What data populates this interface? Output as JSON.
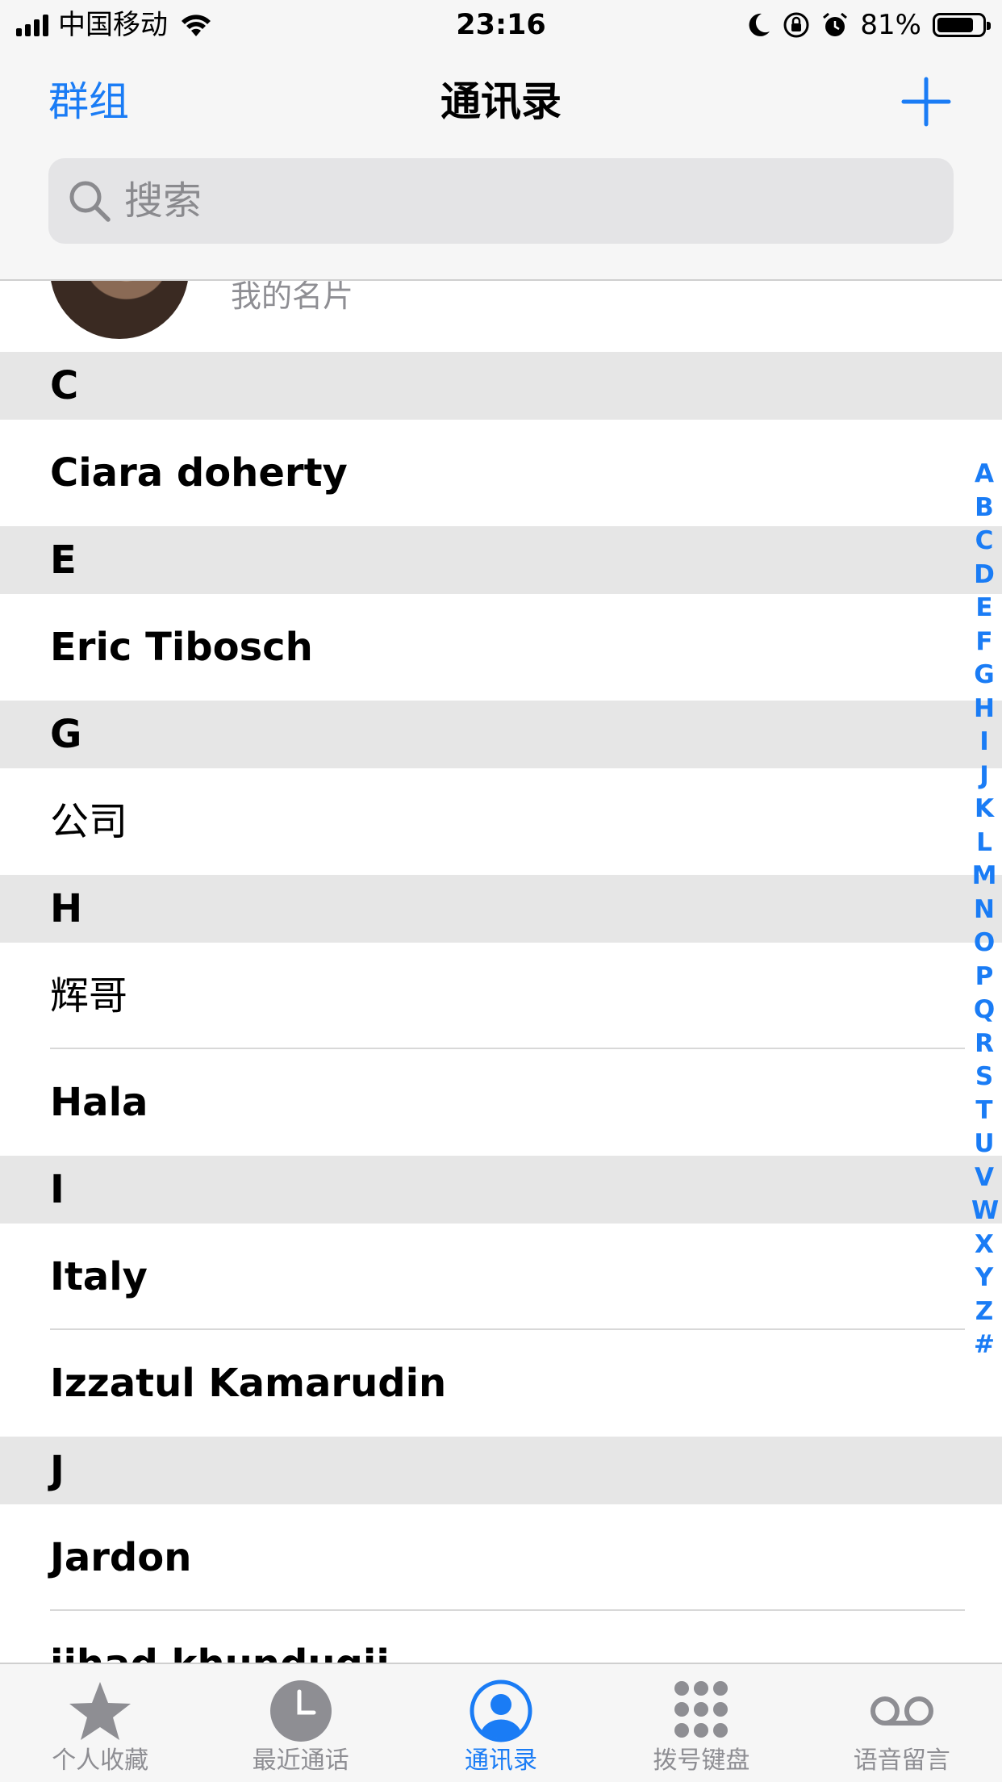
{
  "status_bar": {
    "carrier": "中国移动",
    "time": "23:16",
    "battery_percent": "81%",
    "battery_level": 0.81,
    "icons": [
      "signal-icon",
      "wifi-icon",
      "moon-icon",
      "rotation-lock-icon",
      "alarm-icon",
      "battery-icon"
    ]
  },
  "nav": {
    "groups_label": "群组",
    "title": "通讯录",
    "add_icon": "plus-icon"
  },
  "search": {
    "placeholder": "搜索",
    "icon": "search-icon"
  },
  "my_card": {
    "label": "我的名片"
  },
  "sections": [
    {
      "letter": "C",
      "contacts": [
        "Ciara doherty"
      ]
    },
    {
      "letter": "E",
      "contacts": [
        "Eric Tibosch"
      ]
    },
    {
      "letter": "G",
      "contacts": [
        "公司"
      ]
    },
    {
      "letter": "H",
      "contacts": [
        "辉哥",
        "Hala"
      ]
    },
    {
      "letter": "I",
      "contacts": [
        "Italy",
        "Izzatul Kamarudin"
      ]
    },
    {
      "letter": "J",
      "contacts": [
        "Jardon",
        "jihad khundugii"
      ]
    }
  ],
  "alphabet_index": [
    "A",
    "B",
    "C",
    "D",
    "E",
    "F",
    "G",
    "H",
    "I",
    "J",
    "K",
    "L",
    "M",
    "N",
    "O",
    "P",
    "Q",
    "R",
    "S",
    "T",
    "U",
    "V",
    "W",
    "X",
    "Y",
    "Z",
    "#"
  ],
  "tab_bar": {
    "tabs": [
      {
        "label": "个人收藏",
        "icon": "star-icon",
        "active": false
      },
      {
        "label": "最近通话",
        "icon": "clock-icon",
        "active": false
      },
      {
        "label": "通讯录",
        "icon": "person-circle-icon",
        "active": true
      },
      {
        "label": "拨号键盘",
        "icon": "keypad-icon",
        "active": false
      },
      {
        "label": "语音留言",
        "icon": "voicemail-icon",
        "active": false
      }
    ]
  },
  "colors": {
    "accent": "#1a7cf5",
    "section_header_bg": "#e6e6e6",
    "bar_bg": "#f6f6f6",
    "secondary_text": "#8e8e93"
  }
}
